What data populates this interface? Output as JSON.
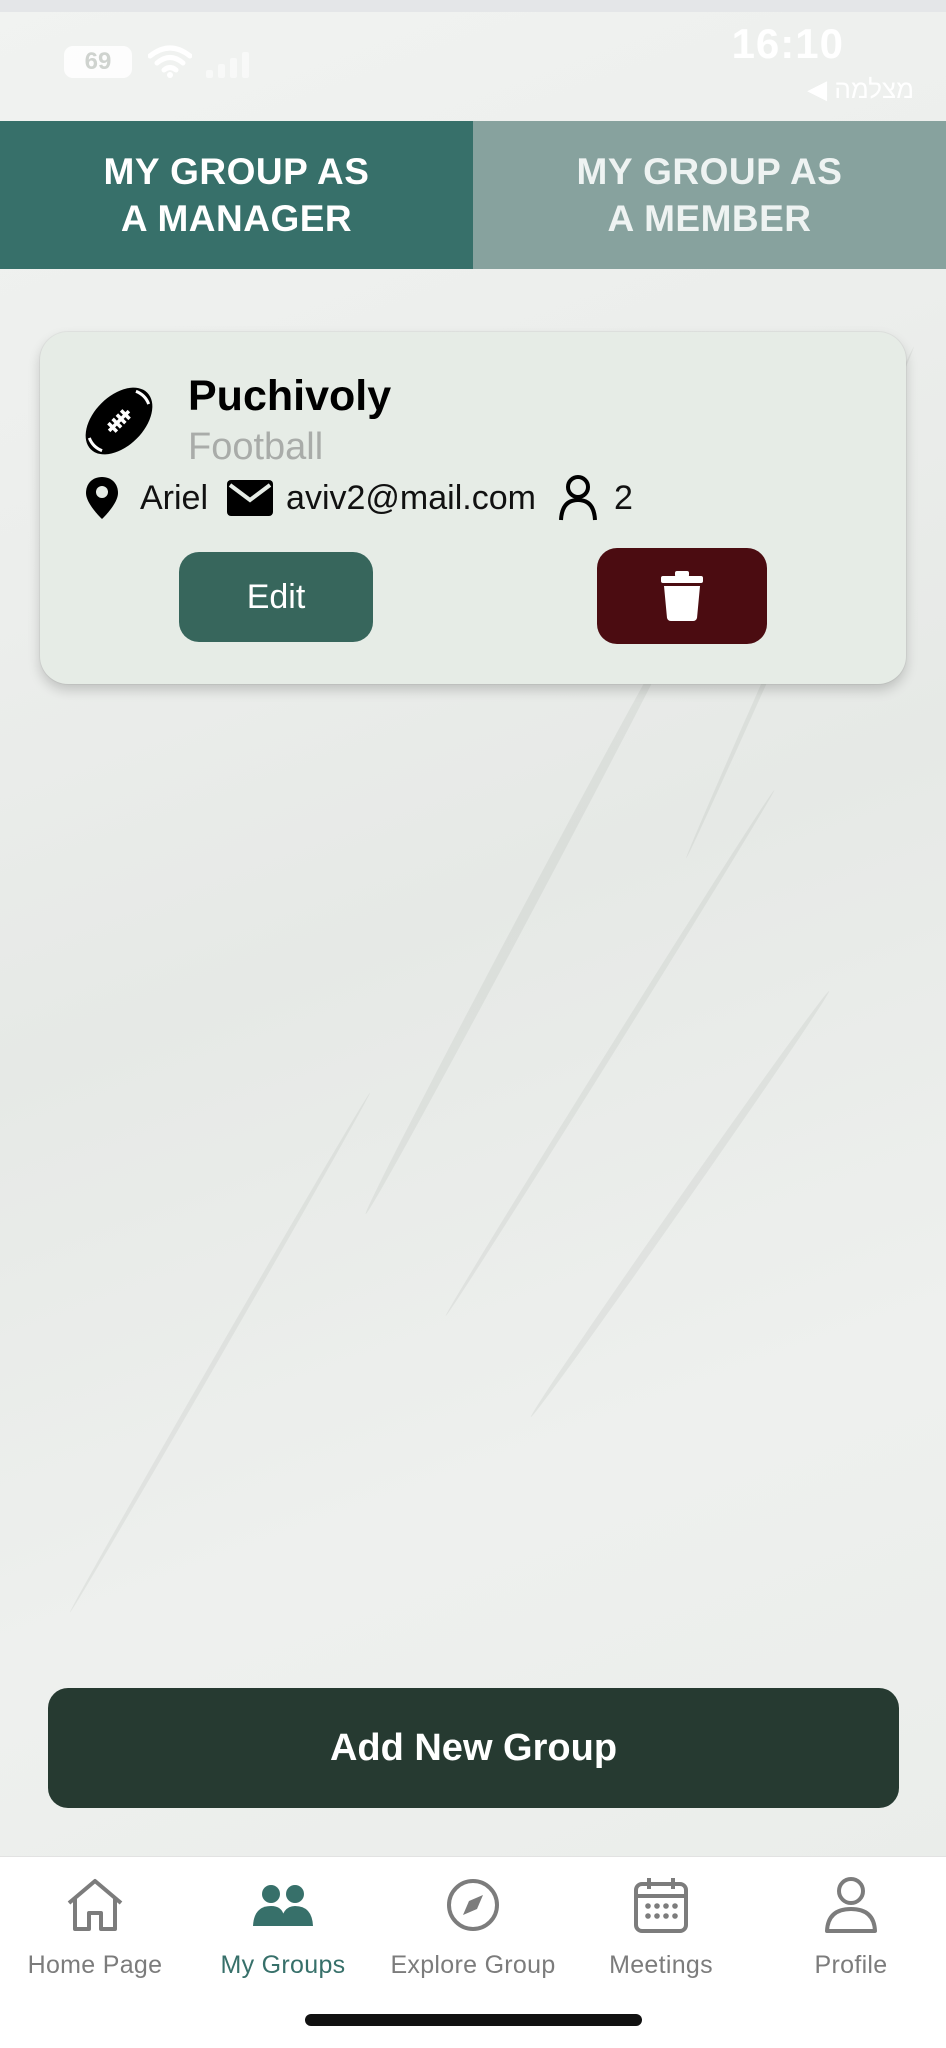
{
  "status_bar": {
    "time": "16:10",
    "battery": "69",
    "back_label": "◀ מצלמה"
  },
  "tabs": [
    {
      "label": "MY GROUP AS\nA MANAGER",
      "active": true
    },
    {
      "label": "MY GROUP AS\nA MEMBER",
      "active": false
    }
  ],
  "group_card": {
    "name": "Puchivoly",
    "sport": "Football",
    "sport_icon": "football-icon",
    "location": "Ariel",
    "email": "aviv2@mail.com",
    "members_count": "2",
    "edit_label": "Edit",
    "delete_icon": "trash-icon"
  },
  "add_button": {
    "label": "Add New Group"
  },
  "bottom_nav": [
    {
      "label": "Home Page",
      "icon": "home-icon",
      "active": false
    },
    {
      "label": "My Groups",
      "icon": "groups-icon",
      "active": true
    },
    {
      "label": "Explore Group",
      "icon": "compass-icon",
      "active": false
    },
    {
      "label": "Meetings",
      "icon": "calendar-icon",
      "active": false
    },
    {
      "label": "Profile",
      "icon": "profile-icon",
      "active": false
    }
  ],
  "colors": {
    "tab_active": "#37706a",
    "tab_inactive": "#87a29e",
    "edit_button": "#37665c",
    "delete_button": "#4b0c11",
    "add_button": "#263a31",
    "nav_active": "#37706a"
  }
}
